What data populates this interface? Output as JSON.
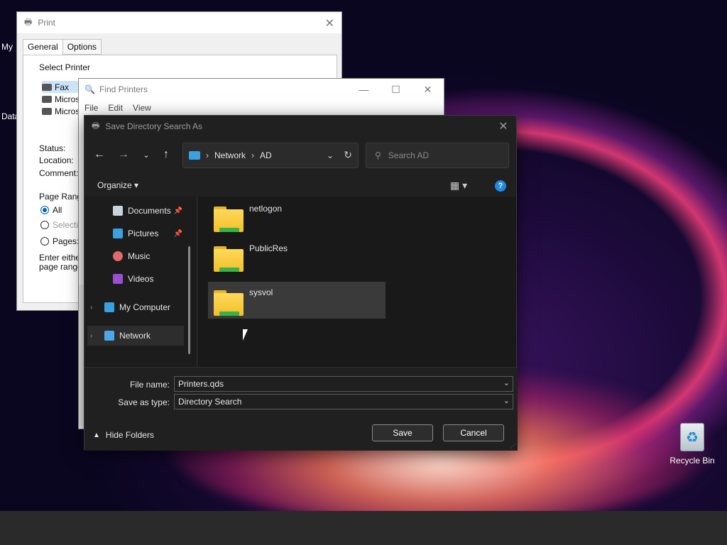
{
  "desktop": {
    "recycle_bin_label": "Recycle Bin",
    "frag_my": "My",
    "frag_data": "Data"
  },
  "print_dialog": {
    "title": "Print",
    "tabs": [
      "General",
      "Options"
    ],
    "select_printer_label": "Select Printer",
    "printers": [
      "Fax",
      "Micros",
      "Micros"
    ],
    "status_label": "Status:",
    "location_label": "Location:",
    "comment_label": "Comment:",
    "page_range_label": "Page Range",
    "range_all": "All",
    "range_selection": "Selection",
    "range_pages": "Pages:",
    "enter_either_line1": "Enter either",
    "enter_either_line2": "page range."
  },
  "find_printers": {
    "title": "Find Printers",
    "menu": [
      "File",
      "Edit",
      "View"
    ]
  },
  "save_dialog": {
    "title": "Save Directory Search As",
    "address": {
      "segments": [
        "Network",
        "AD"
      ]
    },
    "search_placeholder": "Search AD",
    "organize_label": "Organize",
    "nav_items": [
      {
        "label": "Documents",
        "pinned": true
      },
      {
        "label": "Pictures",
        "pinned": true
      },
      {
        "label": "Music",
        "pinned": false
      },
      {
        "label": "Videos",
        "pinned": false
      },
      {
        "label": "My Computer",
        "pinned": false
      },
      {
        "label": "Network",
        "pinned": false
      }
    ],
    "folders": [
      {
        "name": "netlogon"
      },
      {
        "name": "PublicRes"
      },
      {
        "name": "sysvol"
      }
    ],
    "file_name_label": "File name:",
    "file_name_value": "Printers.qds",
    "save_as_type_label": "Save as type:",
    "save_as_type_value": "Directory Search",
    "hide_folders_label": "Hide Folders",
    "save_button": "Save",
    "cancel_button": "Cancel"
  },
  "colors": {
    "dialog_bg": "#202020",
    "accent": "#1e88e5",
    "folder_yellow": "#f2bf2a"
  }
}
